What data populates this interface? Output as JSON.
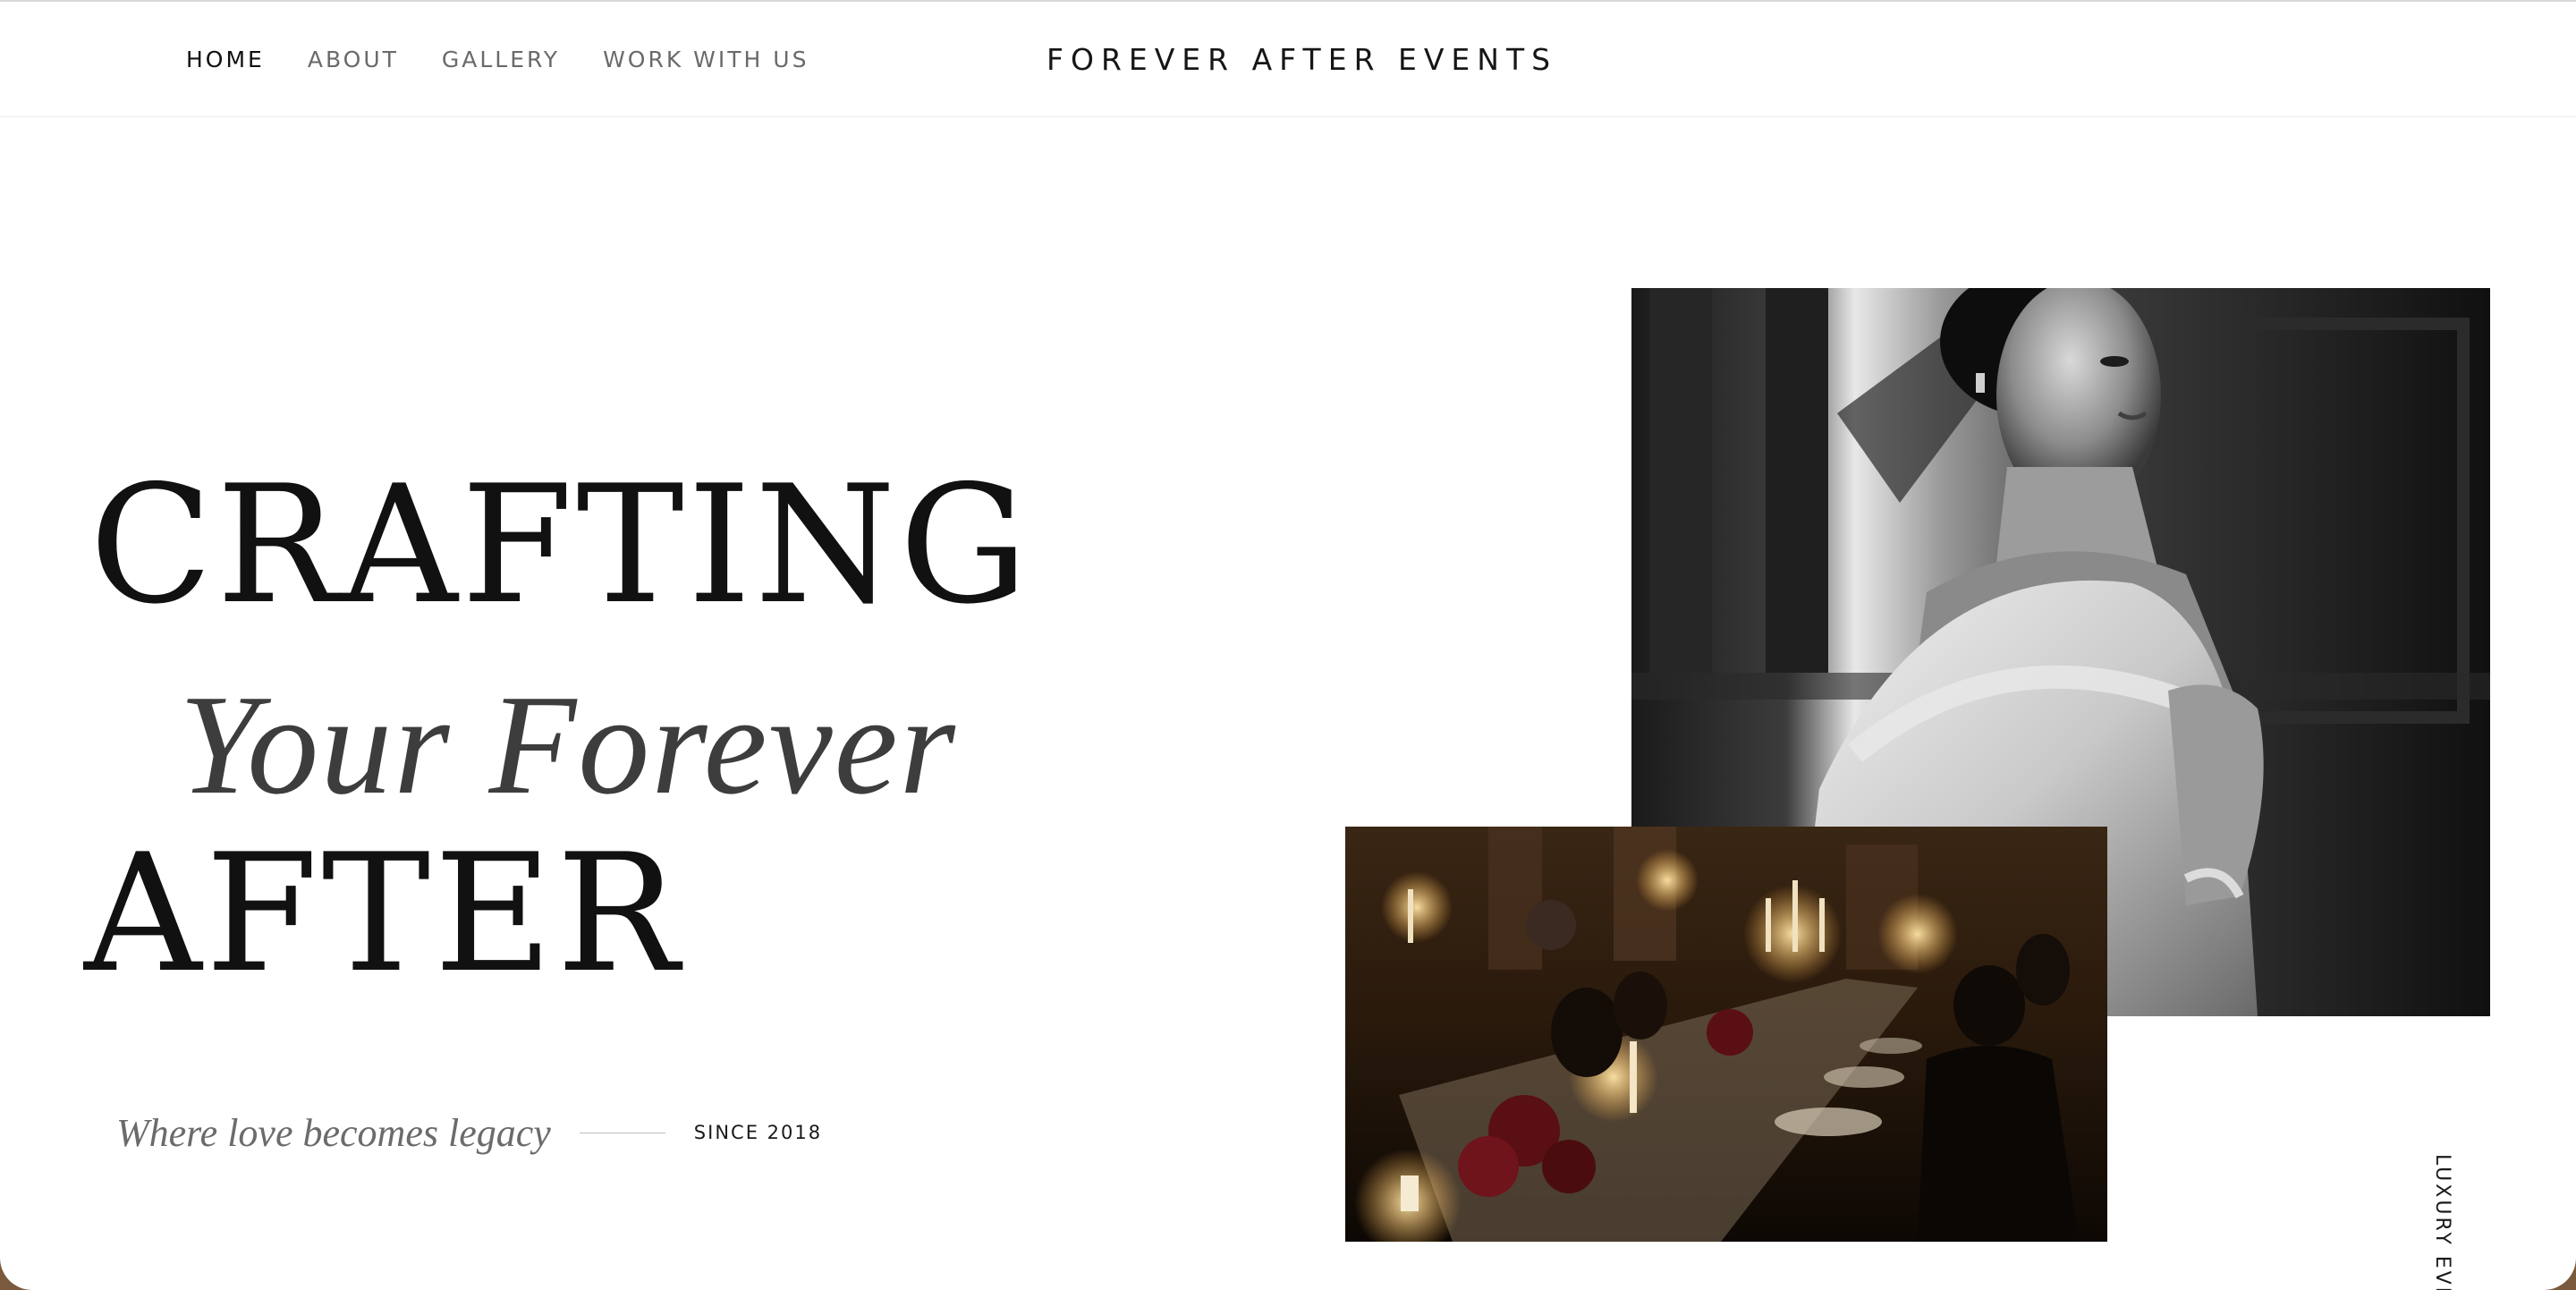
{
  "nav": {
    "links": [
      {
        "label": "HOME",
        "active": true
      },
      {
        "label": "ABOUT",
        "active": false
      },
      {
        "label": "GALLERY",
        "active": false
      },
      {
        "label": "WORK WITH US",
        "active": false
      }
    ],
    "brand": "FOREVER AFTER EVENTS"
  },
  "hero": {
    "line1": "CRAFTING",
    "line2": "Your Forever",
    "line3": "AFTER",
    "tagline": "Where love becomes legacy",
    "since": "SINCE 2018",
    "side_label": "LUXURY EVE"
  },
  "colors": {
    "text_primary": "#111111",
    "text_muted": "#6b6b6b",
    "background": "#ffffff"
  }
}
